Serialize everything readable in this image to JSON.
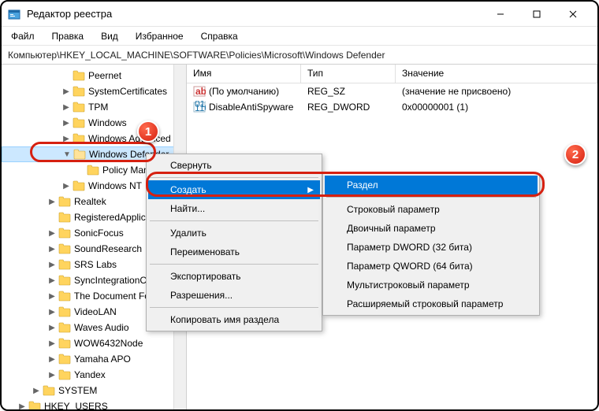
{
  "window": {
    "title": "Редактор реестра"
  },
  "menu": {
    "file": "Файл",
    "edit": "Правка",
    "view": "Вид",
    "favorites": "Избранное",
    "help": "Справка"
  },
  "address": "Компьютер\\HKEY_LOCAL_MACHINE\\SOFTWARE\\Policies\\Microsoft\\Windows Defender",
  "tree": {
    "items": [
      {
        "label": "Peernet",
        "indent": "indent2",
        "exp": ""
      },
      {
        "label": "SystemCertificates",
        "indent": "indent2",
        "exp": "▶"
      },
      {
        "label": "TPM",
        "indent": "indent2",
        "exp": "▶"
      },
      {
        "label": "Windows",
        "indent": "indent2",
        "exp": "▶"
      },
      {
        "label": "Windows Advanced …",
        "indent": "indent2",
        "exp": "▶"
      },
      {
        "label": "Windows Defender",
        "indent": "indent2",
        "exp": "▼",
        "selected": true
      },
      {
        "label": "Policy Manager",
        "indent": "indent3",
        "exp": ""
      },
      {
        "label": "Windows NT",
        "indent": "indent2",
        "exp": "▶"
      },
      {
        "label": "Realtek",
        "indent": "indent1",
        "exp": "▶"
      },
      {
        "label": "RegisteredApplications",
        "indent": "indent1",
        "exp": ""
      },
      {
        "label": "SonicFocus",
        "indent": "indent1",
        "exp": "▶"
      },
      {
        "label": "SoundResearch",
        "indent": "indent1",
        "exp": "▶"
      },
      {
        "label": "SRS Labs",
        "indent": "indent1",
        "exp": "▶"
      },
      {
        "label": "SyncIntegrationClients",
        "indent": "indent1",
        "exp": "▶"
      },
      {
        "label": "The Document Foundation",
        "indent": "indent1",
        "exp": "▶"
      },
      {
        "label": "VideoLAN",
        "indent": "indent1",
        "exp": "▶"
      },
      {
        "label": "Waves Audio",
        "indent": "indent1",
        "exp": "▶"
      },
      {
        "label": "WOW6432Node",
        "indent": "indent1",
        "exp": "▶"
      },
      {
        "label": "Yamaha APO",
        "indent": "indent1",
        "exp": "▶"
      },
      {
        "label": "Yandex",
        "indent": "indent1",
        "exp": "▶"
      },
      {
        "label": "SYSTEM",
        "indent": "indentroot",
        "exp": "▶"
      },
      {
        "label": "HKEY_USERS",
        "indent": "indenthk",
        "exp": "▶"
      }
    ]
  },
  "list": {
    "headers": {
      "name": "Имя",
      "type": "Тип",
      "value": "Значение"
    },
    "rows": [
      {
        "name": "(По умолчанию)",
        "type": "REG_SZ",
        "value": "(значение не присвоено)",
        "icon": "sz"
      },
      {
        "name": "DisableAntiSpyware",
        "type": "REG_DWORD",
        "value": "0x00000001 (1)",
        "icon": "dw"
      }
    ]
  },
  "ctxmenu": {
    "collapse": "Свернуть",
    "new": "Создать",
    "find": "Найти...",
    "delete": "Удалить",
    "rename": "Переименовать",
    "export": "Экспортировать",
    "permissions": "Разрешения...",
    "copykey": "Копировать имя раздела"
  },
  "submenu": {
    "key": "Раздел",
    "string": "Строковый параметр",
    "binary": "Двоичный параметр",
    "dword": "Параметр DWORD (32 бита)",
    "qword": "Параметр QWORD (64 бита)",
    "multi": "Мультистроковый параметр",
    "expand": "Расширяемый строковый параметр"
  },
  "badges": {
    "b1": "1",
    "b2": "2"
  }
}
